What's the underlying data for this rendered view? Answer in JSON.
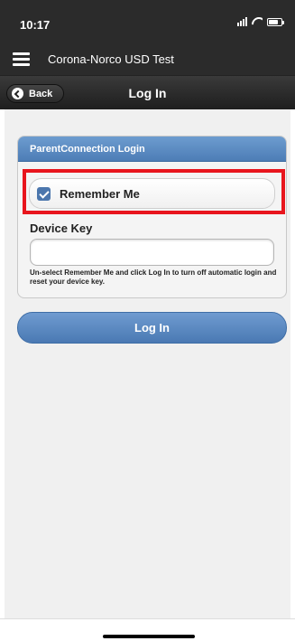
{
  "status_bar": {
    "time": "10:17"
  },
  "header": {
    "app_title": "Corona-Norco USD Test"
  },
  "nav": {
    "back_label": "Back",
    "title": "Log In"
  },
  "panel": {
    "title": "ParentConnection Login",
    "remember_me": {
      "label": "Remember Me",
      "checked": true
    },
    "device_key": {
      "label": "Device Key",
      "value": "",
      "help": "Un-select Remember Me and click Log In to turn off automatic login and reset your device key."
    }
  },
  "login_button_label": "Log In",
  "colors": {
    "header_bg": "#2b2b2b",
    "accent_blue": "#4d7db6",
    "highlight_red": "#e8151d",
    "content_bg": "#f0f0f0"
  }
}
